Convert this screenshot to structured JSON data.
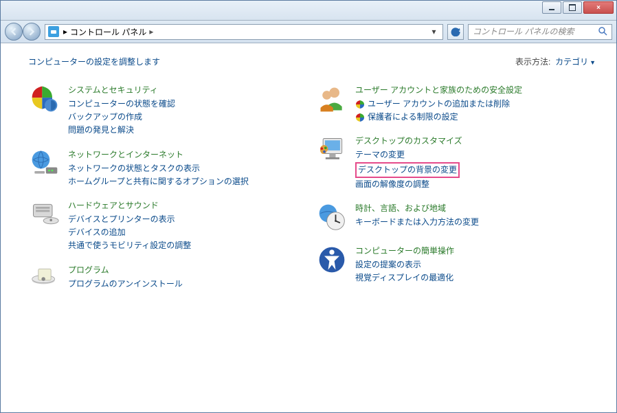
{
  "window": {
    "close": "×"
  },
  "address": {
    "root_arrow": "▸",
    "title": "コントロール パネル",
    "breadcrumb_arrow": "▸",
    "dropdown": "▾"
  },
  "search": {
    "placeholder": "コントロール パネルの検索"
  },
  "header": {
    "text": "コンピューターの設定を調整します"
  },
  "view": {
    "label": "表示方法:",
    "mode": "カテゴリ"
  },
  "cats": {
    "security": {
      "title": "システムとセキュリティ",
      "links": [
        "コンピューターの状態を確認",
        "バックアップの作成",
        "問題の発見と解決"
      ]
    },
    "network": {
      "title": "ネットワークとインターネット",
      "links": [
        "ネットワークの状態とタスクの表示",
        "ホームグループと共有に関するオプションの選択"
      ]
    },
    "hardware": {
      "title": "ハードウェアとサウンド",
      "links": [
        "デバイスとプリンターの表示",
        "デバイスの追加",
        "共通で使うモビリティ設定の調整"
      ]
    },
    "programs": {
      "title": "プログラム",
      "links": [
        "プログラムのアンインストール"
      ]
    },
    "users": {
      "title": "ユーザー アカウントと家族のための安全設定",
      "links": [
        "ユーザー アカウントの追加または削除",
        "保護者による制限の設定"
      ]
    },
    "appearance": {
      "title": "デスクトップのカスタマイズ",
      "links": [
        "テーマの変更",
        "デスクトップの背景の変更",
        "画面の解像度の調整"
      ]
    },
    "clock": {
      "title": "時計、言語、および地域",
      "links": [
        "キーボードまたは入力方法の変更"
      ]
    },
    "ease": {
      "title": "コンピューターの簡単操作",
      "links": [
        "設定の提案の表示",
        "視覚ディスプレイの最適化"
      ]
    }
  }
}
